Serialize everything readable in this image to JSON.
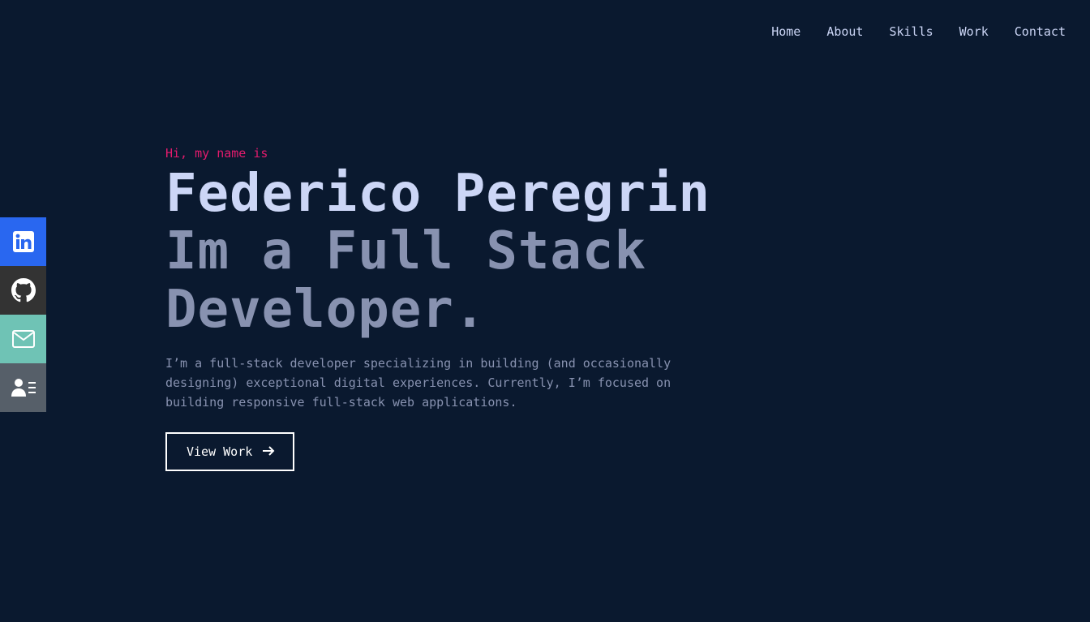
{
  "nav": {
    "items": [
      {
        "label": "Home"
      },
      {
        "label": "About"
      },
      {
        "label": "Skills"
      },
      {
        "label": "Work"
      },
      {
        "label": "Contact"
      }
    ]
  },
  "social": {
    "items": [
      {
        "icon": "linkedin-icon",
        "color": "#2967f0"
      },
      {
        "icon": "github-icon",
        "color": "#333333"
      },
      {
        "icon": "mail-icon",
        "color": "#6fc3b5"
      },
      {
        "icon": "contact-card-icon",
        "color": "#565f69"
      }
    ]
  },
  "hero": {
    "greeting": "Hi, my name is",
    "name": "Federico Peregrin",
    "role": "Im a Full Stack Developer.",
    "description": "I’m a full-stack developer specializing in building (and occasionally designing) exceptional digital experiences. Currently, I’m focused on building responsive full-stack web applications.",
    "cta_label": "View Work",
    "cta_icon": "arrow-right-icon"
  },
  "colors": {
    "background": "#0a192f",
    "accent": "#e31b6d",
    "heading": "#ccd6f6",
    "muted": "#8892b0"
  }
}
